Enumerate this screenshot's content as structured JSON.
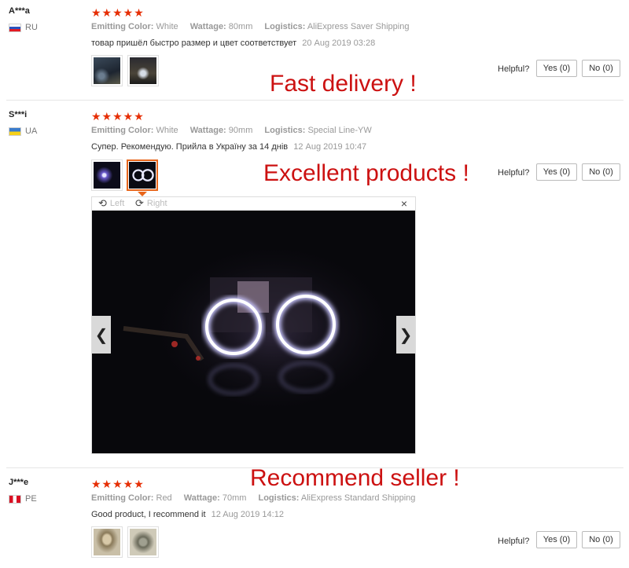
{
  "reviews": [
    {
      "user": "A***a",
      "country": "RU",
      "stars": "★★★★★",
      "meta": [
        {
          "key": "Emitting Color:",
          "value": "White"
        },
        {
          "key": "Wattage:",
          "value": "80mm"
        },
        {
          "key": "Logistics:",
          "value": "AliExpress Saver Shipping"
        }
      ],
      "text": "товар пришёл быстро размер и цвет соответствует",
      "date": "20 Aug 2019 03:28",
      "overlay": "Fast delivery !"
    },
    {
      "user": "S***i",
      "country": "UA",
      "stars": "★★★★★",
      "meta": [
        {
          "key": "Emitting Color:",
          "value": "White"
        },
        {
          "key": "Wattage:",
          "value": "90mm"
        },
        {
          "key": "Logistics:",
          "value": "Special Line-YW"
        }
      ],
      "text": "Супер. Рекомендую. Прийла в Україну за 14 днів",
      "date": "12 Aug 2019 10:47",
      "overlay": "Excellent products !"
    },
    {
      "user": "J***e",
      "country": "PE",
      "stars": "★★★★★",
      "meta": [
        {
          "key": "Emitting Color:",
          "value": "Red"
        },
        {
          "key": "Wattage:",
          "value": "70mm"
        },
        {
          "key": "Logistics:",
          "value": "AliExpress Standard Shipping"
        }
      ],
      "text": "Good product, I recommend it",
      "date": "12 Aug 2019 14:12",
      "overlay": "Recommend seller !"
    }
  ],
  "helpful": {
    "label": "Helpful?",
    "yes": "Yes (0)",
    "no": "No (0)"
  },
  "viewer": {
    "left_label": "Left",
    "right_label": "Right",
    "close": "×",
    "prev": "❮",
    "next": "❯"
  },
  "colors": {
    "stars": "#e62e04",
    "overlay_text": "#cc1111",
    "active_thumb": "#e8661b"
  },
  "icons": [
    "rotate-left-icon",
    "rotate-right-icon",
    "close-icon",
    "chevron-left-icon",
    "chevron-right-icon"
  ]
}
